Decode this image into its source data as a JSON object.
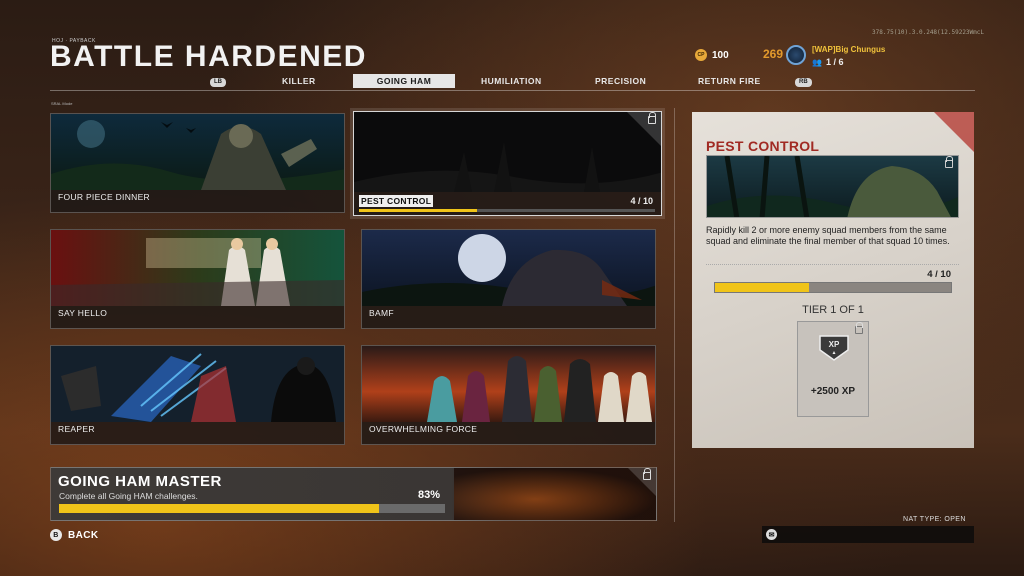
{
  "version": "378.75(10).3.0.248(12.59223WmcL",
  "breadcrumb": "HOJ · PAYBACK",
  "title": "BATTLE HARDENED",
  "currency": {
    "icon": "cod-points-icon",
    "label": "CP",
    "value": "100"
  },
  "player": {
    "level": "269",
    "name": "[WAP]Big Chungus",
    "party": "1 / 6"
  },
  "tabs": {
    "lb": "LB",
    "rb": "RB",
    "items": [
      "KILLER",
      "GOING HAM",
      "HUMILIATION",
      "PRECISION",
      "RETURN FIRE"
    ],
    "active_index": 1
  },
  "section_label": "SRAL Mode",
  "challenges": [
    {
      "name": "FOUR PIECE DINNER"
    },
    {
      "name": "PEST CONTROL",
      "progress": "4 / 10",
      "progress_fraction": 0.4
    },
    {
      "name": "SAY HELLO"
    },
    {
      "name": "BAMF"
    },
    {
      "name": "REAPER"
    },
    {
      "name": "OVERWHELMING FORCE"
    }
  ],
  "master": {
    "title": "GOING HAM MASTER",
    "description": "Complete all Going HAM challenges.",
    "percent": "83%",
    "fraction": 0.83
  },
  "detail": {
    "title": "PEST CONTROL",
    "description": "Rapidly kill 2 or more enemy squad members from the same squad and eliminate the final member of that squad 10 times.",
    "progress": "4 / 10",
    "fraction": 0.4,
    "tier": "TIER 1 OF 1",
    "reward": "+2500  XP"
  },
  "footer": {
    "back": "BACK",
    "back_button": "B",
    "nat": "NAT TYPE: OPEN"
  },
  "colors": {
    "accent": "#f0c419",
    "detail_title": "#a12a23",
    "level": "#e39a2c"
  }
}
